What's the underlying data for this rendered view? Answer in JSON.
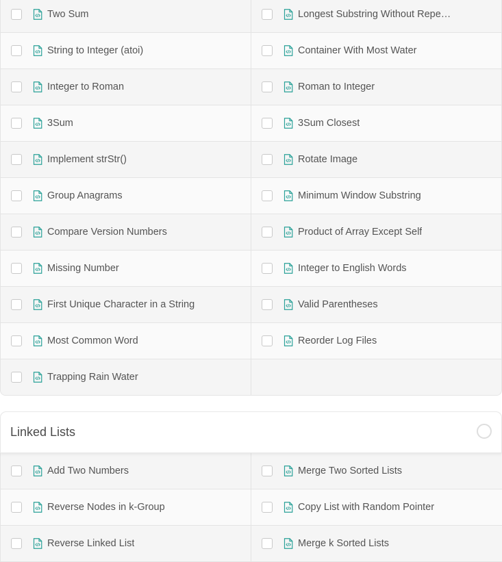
{
  "sections": [
    {
      "title": "",
      "rows": [
        [
          "Two Sum",
          "Longest Substring Without Repe…"
        ],
        [
          "String to Integer (atoi)",
          "Container With Most Water"
        ],
        [
          "Integer to Roman",
          "Roman to Integer"
        ],
        [
          "3Sum",
          "3Sum Closest"
        ],
        [
          "Implement strStr()",
          "Rotate Image"
        ],
        [
          "Group Anagrams",
          "Minimum Window Substring"
        ],
        [
          "Compare Version Numbers",
          "Product of Array Except Self"
        ],
        [
          "Missing Number",
          "Integer to English Words"
        ],
        [
          "First Unique Character in a String",
          "Valid Parentheses"
        ],
        [
          "Most Common Word",
          "Reorder Log Files"
        ],
        [
          "Trapping Rain Water",
          ""
        ]
      ]
    },
    {
      "title": "Linked Lists",
      "progress": 0,
      "rows": [
        [
          "Add Two Numbers",
          "Merge Two Sorted Lists"
        ],
        [
          "Reverse Nodes in k-Group",
          "Copy List with Random Pointer"
        ],
        [
          "Reverse Linked List",
          "Merge k Sorted Lists"
        ]
      ]
    }
  ],
  "colors": {
    "icon": "#2aa198",
    "border": "#e4e4e4"
  },
  "icons": {
    "problem": "file-code-icon",
    "status": "progress-ring-icon"
  }
}
